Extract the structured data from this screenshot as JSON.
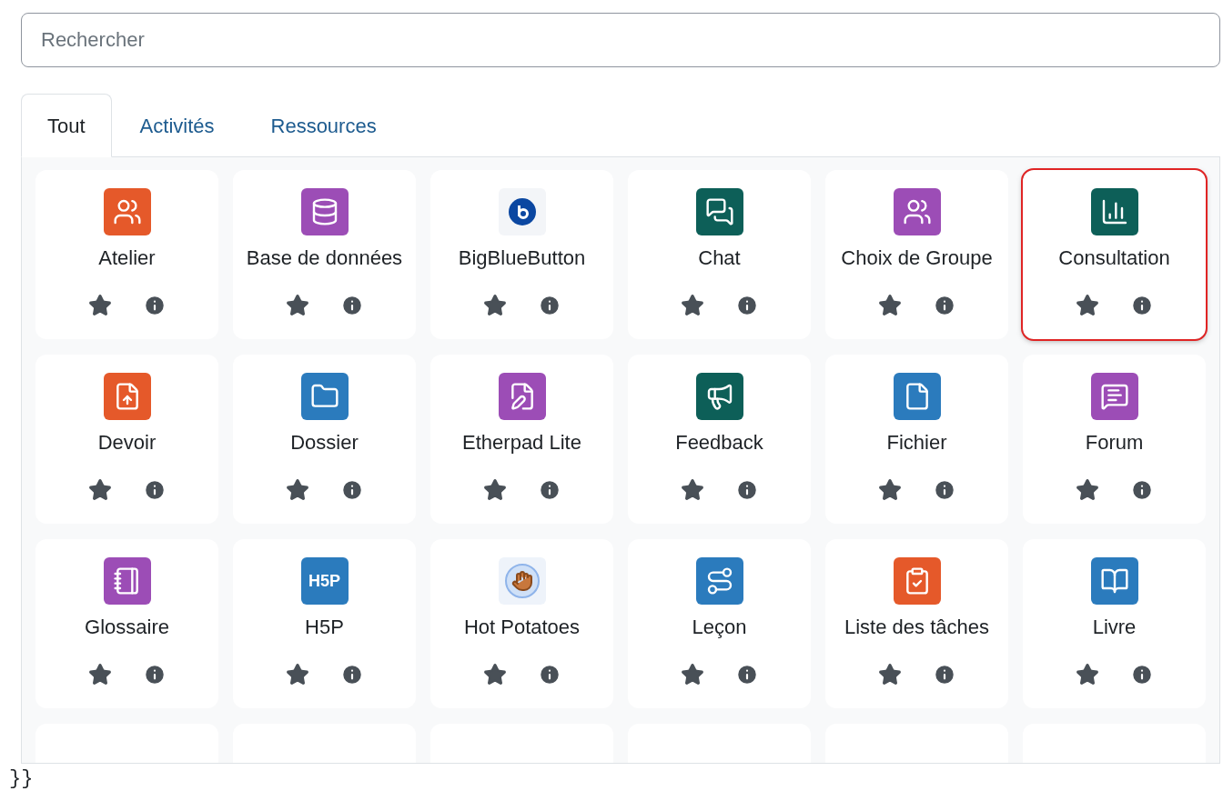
{
  "search": {
    "placeholder": "Rechercher"
  },
  "tabs": [
    {
      "label": "Tout",
      "selected": true
    },
    {
      "label": "Activités",
      "selected": false
    },
    {
      "label": "Ressources",
      "selected": false
    }
  ],
  "items": [
    {
      "label": "Atelier",
      "kind": "workshop",
      "color": "#e5592a",
      "starred": false,
      "highlighted": false
    },
    {
      "label": "Base de données",
      "kind": "database",
      "color": "#9c4db6",
      "starred": false,
      "highlighted": false
    },
    {
      "label": "BigBlueButton",
      "kind": "bbb",
      "color": "#0b47a1",
      "starred": false,
      "highlighted": false
    },
    {
      "label": "Chat",
      "kind": "chat",
      "color": "#0d5f58",
      "starred": false,
      "highlighted": false
    },
    {
      "label": "Choix de Groupe",
      "kind": "group",
      "color": "#9c4db6",
      "starred": false,
      "highlighted": false
    },
    {
      "label": "Consultation",
      "kind": "survey",
      "color": "#0d5f58",
      "starred": false,
      "highlighted": true
    },
    {
      "label": "Devoir",
      "kind": "assign",
      "color": "#e5592a",
      "starred": false,
      "highlighted": false
    },
    {
      "label": "Dossier",
      "kind": "folder",
      "color": "#2b7bbd",
      "starred": false,
      "highlighted": false
    },
    {
      "label": "Etherpad Lite",
      "kind": "pad",
      "color": "#9c4db6",
      "starred": false,
      "highlighted": false
    },
    {
      "label": "Feedback",
      "kind": "feedback",
      "color": "#0d5f58",
      "starred": false,
      "highlighted": false
    },
    {
      "label": "Fichier",
      "kind": "file",
      "color": "#2b7bbd",
      "starred": false,
      "highlighted": false
    },
    {
      "label": "Forum",
      "kind": "forum",
      "color": "#9c4db6",
      "starred": false,
      "highlighted": false
    },
    {
      "label": "Glossaire",
      "kind": "glossary",
      "color": "#9c4db6",
      "starred": false,
      "highlighted": false
    },
    {
      "label": "H5P",
      "kind": "h5p",
      "color": "#2b7bbd",
      "starred": false,
      "highlighted": false,
      "icon_text": "H5P"
    },
    {
      "label": "Hot Potatoes",
      "kind": "hotpot",
      "color": "#eef3fa",
      "starred": false,
      "highlighted": false
    },
    {
      "label": "Leçon",
      "kind": "lesson",
      "color": "#2b7bbd",
      "starred": false,
      "highlighted": false
    },
    {
      "label": "Liste des tâches",
      "kind": "checklist",
      "color": "#e5592a",
      "starred": false,
      "highlighted": false
    },
    {
      "label": "Livre",
      "kind": "book",
      "color": "#2b7bbd",
      "starred": false,
      "highlighted": false
    }
  ],
  "footer_text": "}}"
}
